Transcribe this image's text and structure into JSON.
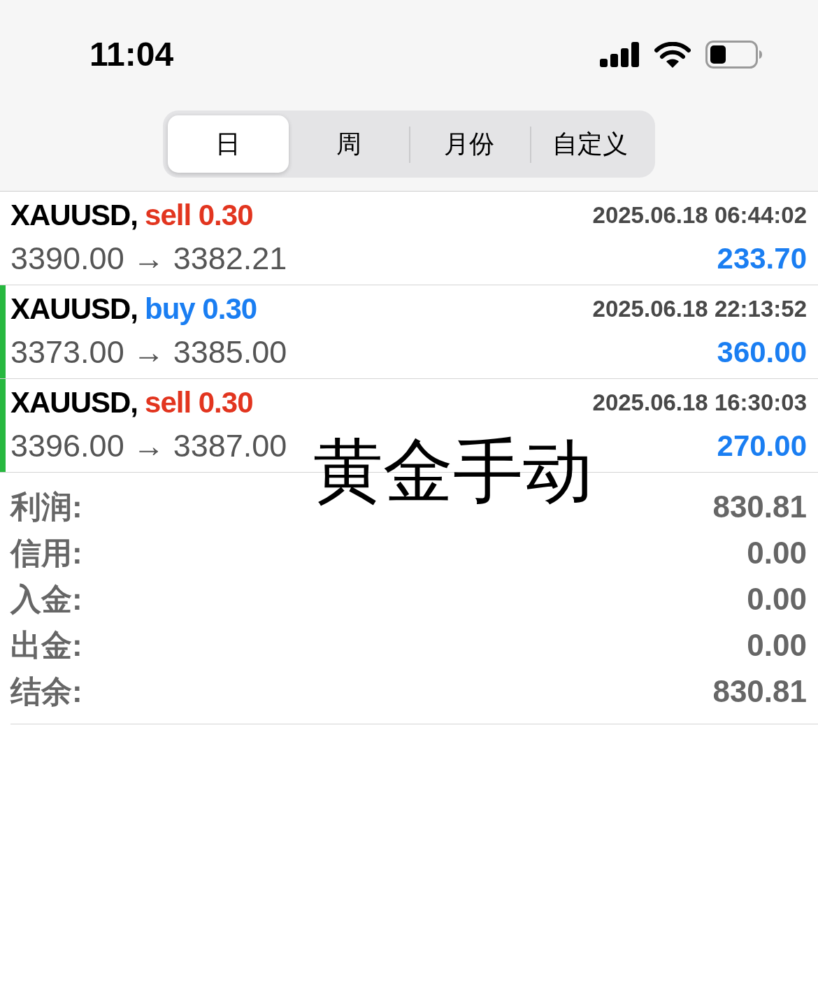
{
  "status_bar": {
    "time": "11:04"
  },
  "period_tabs": [
    {
      "label": "日",
      "selected": true
    },
    {
      "label": "周",
      "selected": false
    },
    {
      "label": "月份",
      "selected": false
    },
    {
      "label": "自定义",
      "selected": false
    }
  ],
  "trades": [
    {
      "symbol": "XAUUSD,",
      "order": "sell 0.30",
      "kind": "sell",
      "time": "2025.06.18 06:44:02",
      "prices": "3390.00 → 3382.21",
      "profit": "233.70",
      "marked": false
    },
    {
      "symbol": "XAUUSD,",
      "order": "buy 0.30",
      "kind": "buy",
      "time": "2025.06.18 22:13:52",
      "prices": "3373.00 → 3385.00",
      "profit": "360.00",
      "marked": true
    },
    {
      "symbol": "XAUUSD,",
      "order": "sell 0.30",
      "kind": "sell",
      "time": "2025.06.18 16:30:03",
      "prices": "3396.00 → 3387.00",
      "profit": "270.00",
      "marked": true
    }
  ],
  "summary": [
    {
      "label": "利润:",
      "value": "830.81"
    },
    {
      "label": "信用:",
      "value": "0.00"
    },
    {
      "label": "入金:",
      "value": "0.00"
    },
    {
      "label": "出金:",
      "value": "0.00"
    },
    {
      "label": "结余:",
      "value": "830.81"
    }
  ],
  "overlay_caption": "黄金手动"
}
